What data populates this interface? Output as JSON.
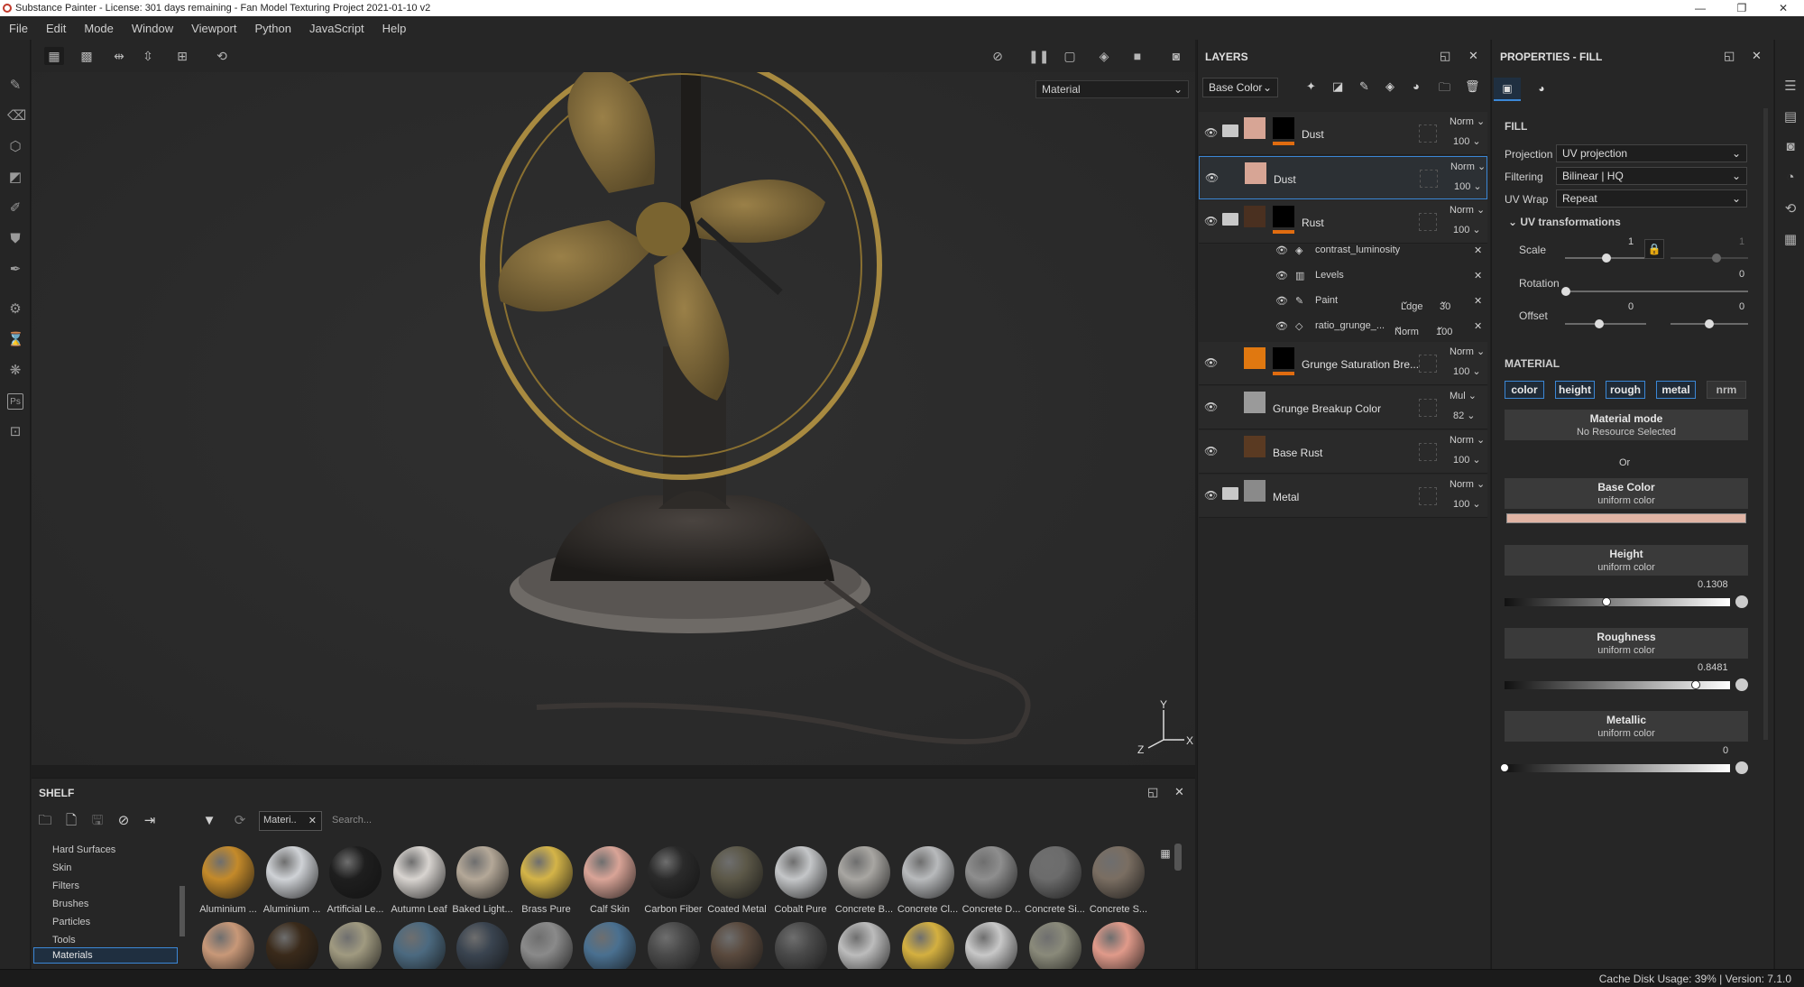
{
  "window": {
    "title": "Substance Painter - License: 301 days remaining - Fan Model Texturing Project 2021-01-10 v2",
    "controls": [
      "—",
      "❐",
      "✕"
    ]
  },
  "menu": [
    "File",
    "Edit",
    "Mode",
    "Window",
    "Viewport",
    "Python",
    "JavaScript",
    "Help"
  ],
  "viewport": {
    "display_mode": "Material",
    "axes": {
      "y": "Y",
      "x": "X",
      "z": "Z"
    }
  },
  "shelf": {
    "title": "SHELF",
    "filter_tag": "Materi..",
    "search_placeholder": "Search...",
    "categories": [
      "Hard Surfaces",
      "Skin",
      "Filters",
      "Brushes",
      "Particles",
      "Tools",
      "Materials"
    ],
    "selected_category": "Materials",
    "materials_row1": [
      {
        "label": "Aluminium ...",
        "color": "#c48a2a"
      },
      {
        "label": "Aluminium ...",
        "color": "#cfd2d6"
      },
      {
        "label": "Artificial Le...",
        "color": "#1e1e1e"
      },
      {
        "label": "Autumn Leaf",
        "color": "#d8d4d0"
      },
      {
        "label": "Baked Light...",
        "color": "#b4a898"
      },
      {
        "label": "Brass Pure",
        "color": "#d4b448"
      },
      {
        "label": "Calf Skin",
        "color": "#d9a497"
      },
      {
        "label": "Carbon Fiber",
        "color": "#2a2a2a"
      },
      {
        "label": "Coated Metal",
        "color": "#5c5848"
      },
      {
        "label": "Cobalt Pure",
        "color": "#c4c6c8"
      },
      {
        "label": "Concrete B...",
        "color": "#a8a6a2"
      },
      {
        "label": "Concrete Cl...",
        "color": "#b8babc"
      },
      {
        "label": "Concrete D...",
        "color": "#8e8e8e"
      },
      {
        "label": "Concrete Si...",
        "color": "#6c6c6c"
      },
      {
        "label": "Concrete S...",
        "color": "#7a6e62"
      }
    ],
    "materials_row2": [
      "#c89878",
      "#3a2a1a",
      "#a09a80",
      "#4c6a80",
      "#3a4450",
      "#8a8a8a",
      "#4a7090",
      "#4a4a4a",
      "#5a4a3e",
      "#4a4a4a",
      "#bcbcbc",
      "#d4b040",
      "#c8c8c8",
      "#8a8a7a",
      "#e09a8a"
    ]
  },
  "layers": {
    "title": "LAYERS",
    "channel": "Base Color",
    "rows": [
      {
        "name": "Dust",
        "blend": "Norm",
        "opacity": "100",
        "folder": true,
        "thumb": "#d7a595",
        "mask": true,
        "underbar": true,
        "selected": false
      },
      {
        "name": "Dust",
        "blend": "Norm",
        "opacity": "100",
        "folder": false,
        "thumb": "#d7a595",
        "mask": false,
        "underbar": false,
        "selected": true
      },
      {
        "name": "Rust",
        "blend": "Norm",
        "opacity": "100",
        "folder": true,
        "thumb": "#4a3020",
        "mask": true,
        "underbar": true,
        "selected": false
      },
      {
        "name": "Grunge Saturation Bre...",
        "blend": "Norm",
        "opacity": "100",
        "folder": false,
        "thumb": "#e07810",
        "mask": true,
        "underbar": true,
        "selected": false
      },
      {
        "name": "Grunge Breakup Color",
        "blend": "Mul",
        "opacity": "82",
        "folder": false,
        "thumb": "#9a9a9a",
        "mask": false,
        "underbar": false,
        "selected": false
      },
      {
        "name": "Base Rust",
        "blend": "Norm",
        "opacity": "100",
        "folder": false,
        "thumb": "#5a3a22",
        "mask": false,
        "underbar": false,
        "selected": false
      },
      {
        "name": "Metal",
        "blend": "Norm",
        "opacity": "100",
        "folder": true,
        "thumb": "#8a8a8a",
        "mask": false,
        "underbar": false,
        "selected": false
      }
    ],
    "effects": [
      {
        "name": "contrast_luminosity",
        "blend": "",
        "opacity": ""
      },
      {
        "name": "Levels",
        "blend": "",
        "opacity": ""
      },
      {
        "name": "Paint",
        "blend": "Ldge",
        "opacity": "30"
      },
      {
        "name": "ratio_grunge_...",
        "blend": "Norm",
        "opacity": "100"
      }
    ]
  },
  "properties": {
    "title": "PROPERTIES - FILL",
    "fill_heading": "FILL",
    "projection_label": "Projection",
    "projection_value": "UV projection",
    "filtering_label": "Filtering",
    "filtering_value": "Bilinear | HQ",
    "uvwrap_label": "UV Wrap",
    "uvwrap_value": "Repeat",
    "uv_transform_heading": "UV transformations",
    "scale_label": "Scale",
    "scale_value": "1",
    "scale_value2": "1",
    "rotation_label": "Rotation",
    "rotation_value": "0",
    "offset_label": "Offset",
    "offset_value1": "0",
    "offset_value2": "0",
    "material_heading": "MATERIAL",
    "channels": [
      "color",
      "height",
      "rough",
      "metal",
      "nrm"
    ],
    "material_mode_title": "Material mode",
    "material_mode_sub": "No Resource Selected",
    "or_text": "Or",
    "base_color_title": "Base Color",
    "base_color_sub": "uniform color",
    "base_color_hex": "#e0b4a4",
    "height_title": "Height",
    "height_sub": "uniform color",
    "height_value": "0.1308",
    "roughness_title": "Roughness",
    "roughness_sub": "uniform color",
    "roughness_value": "0.8481",
    "metallic_title": "Metallic",
    "metallic_sub": "uniform color",
    "metallic_value": "0"
  },
  "status": {
    "text": "Cache Disk Usage: 39% | Version: 7.1.0"
  }
}
